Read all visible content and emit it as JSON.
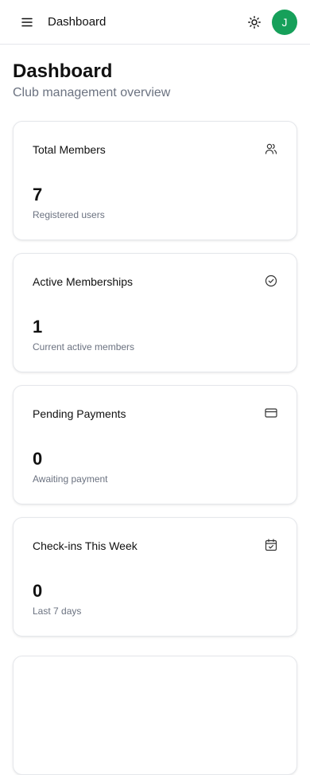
{
  "header": {
    "title": "Dashboard",
    "avatar_initial": "J",
    "menu_icon": "menu-icon",
    "theme_icon": "sun-icon"
  },
  "page": {
    "title": "Dashboard",
    "subtitle": "Club management overview"
  },
  "stats": [
    {
      "title": "Total Members",
      "value": "7",
      "description": "Registered users",
      "icon": "users-icon"
    },
    {
      "title": "Active Memberships",
      "value": "1",
      "description": "Current active members",
      "icon": "check-circle-icon"
    },
    {
      "title": "Pending Payments",
      "value": "0",
      "description": "Awaiting payment",
      "icon": "credit-card-icon"
    },
    {
      "title": "Check-ins This Week",
      "value": "0",
      "description": "Last 7 days",
      "icon": "calendar-check-icon"
    }
  ],
  "colors": {
    "avatar_bg": "#16a05a",
    "muted_text": "#6b7280",
    "border": "#e5e7eb"
  }
}
